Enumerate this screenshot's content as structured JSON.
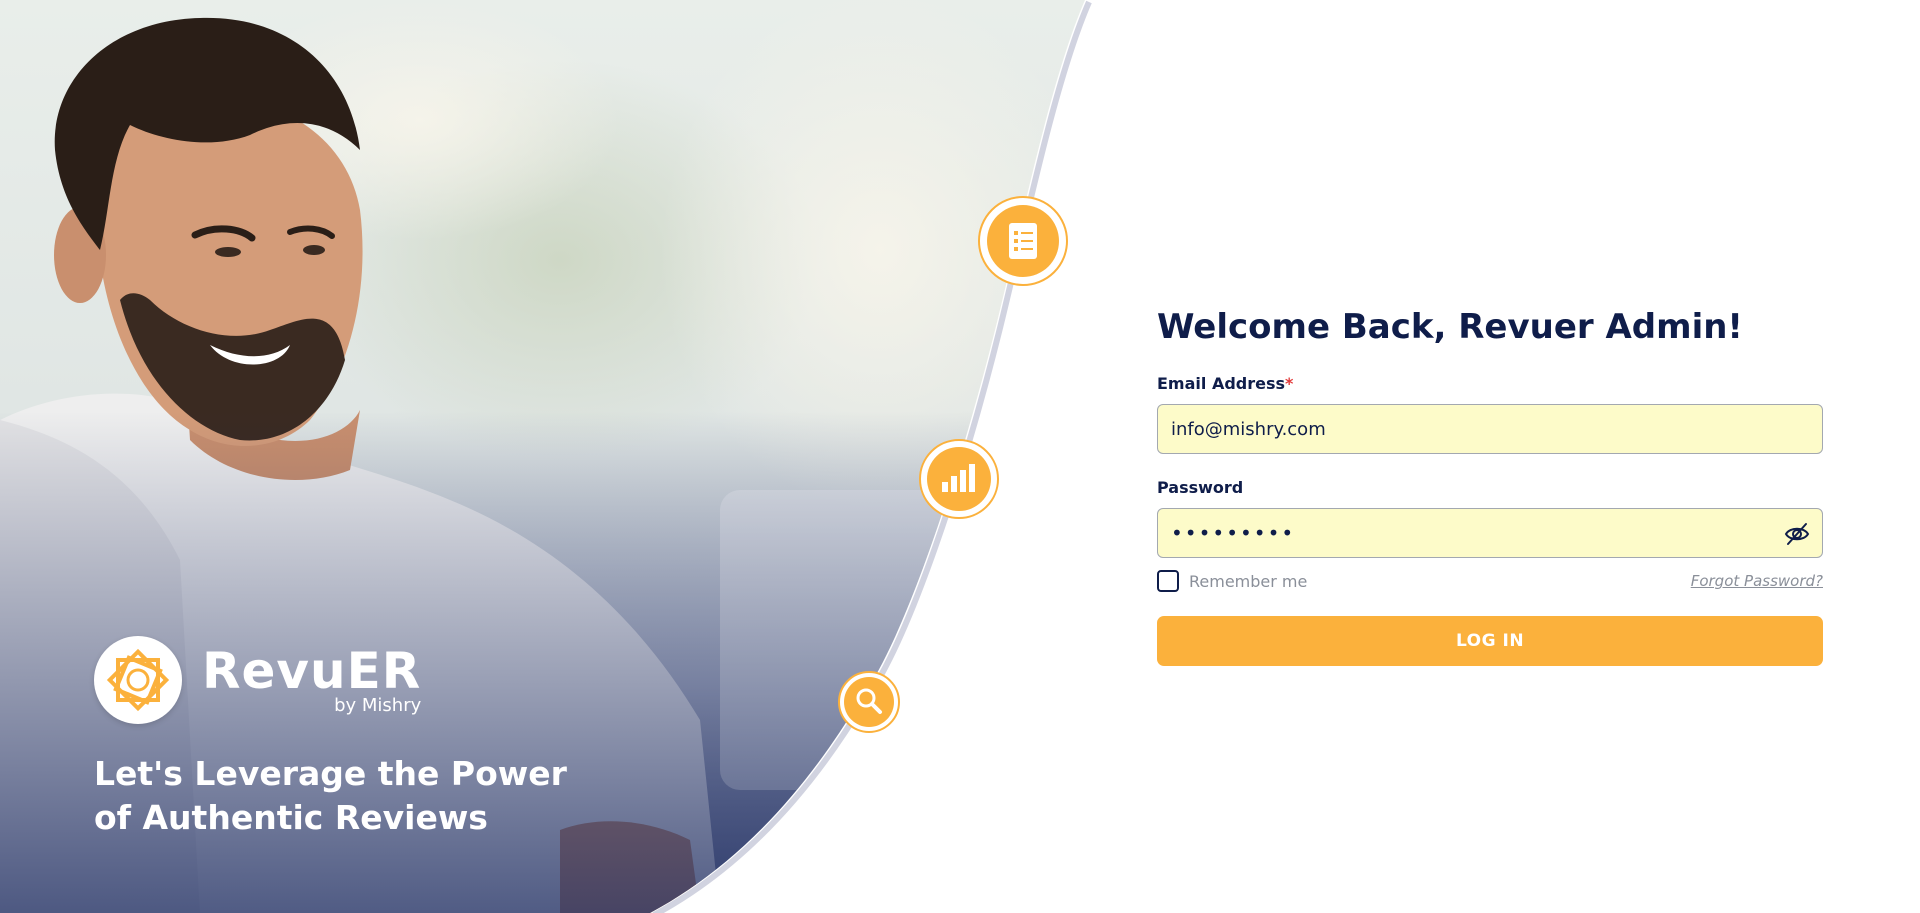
{
  "hero": {
    "brand_name": "RevuER",
    "brand_sub": "by Mishry",
    "tagline": "Let's Leverage the Power of Authentic Reviews"
  },
  "login": {
    "welcome_prefix": "Welcome Back, ",
    "welcome_name": "Revuer Admin!",
    "email_label": "Email Address",
    "required_mark": "*",
    "email_value": "info@mishry.com",
    "password_label": "Password",
    "password_value": "123456789",
    "remember_label": "Remember me",
    "forgot_label": "Forgot Password?",
    "submit_label": "LOG IN"
  },
  "icons": [
    "document-list-icon",
    "bar-chart-icon",
    "magnifier-icon",
    "eye-slash-icon",
    "revuer-logo-icon"
  ],
  "colors": {
    "accent": "#fbb13c",
    "navy": "#0f1d4a",
    "input_bg": "#fdfbc9",
    "muted": "#8a8f99"
  }
}
